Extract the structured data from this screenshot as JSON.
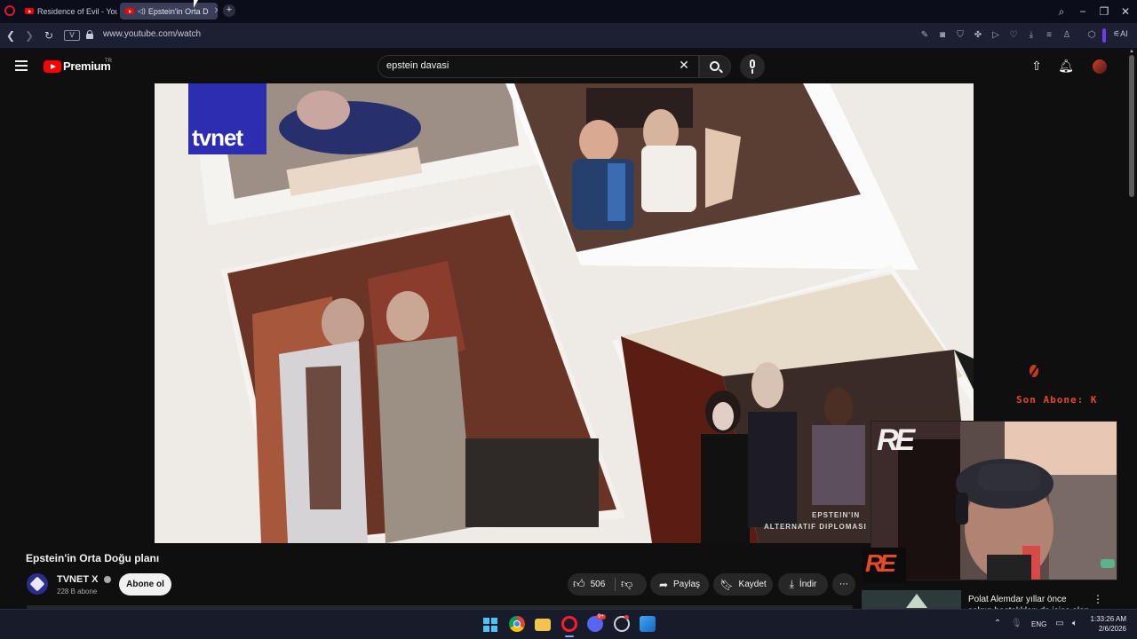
{
  "browser": {
    "tabs": [
      {
        "label": "Residence of Evil - YouTub",
        "active": false
      },
      {
        "label": "Epstein'in Orta D",
        "active": true
      }
    ],
    "new_tab": "+",
    "url": "www.youtube.com/watch",
    "url_badge": "V"
  },
  "youtube": {
    "logo_text": "Premium",
    "logo_region": "TR",
    "search_value": "epstein davasi"
  },
  "video": {
    "brand_overlay": "tvnet",
    "caption_line1": "EPSTEIN'IN",
    "caption_line2": "ALTERNATIF DIPLOMASI"
  },
  "overlay": {
    "son_abone": "Son Abone: K",
    "cam_logo": "RE",
    "colors": {
      "accent": "#e24a2a"
    }
  },
  "info": {
    "title": "Epstein'in Orta Doğu planı",
    "channel": "TVNET X",
    "subscribers": "228 B abone",
    "subscribe": "Abone ol",
    "likes": "506",
    "share": "Paylaş",
    "save": "Kaydet",
    "download": "İndir",
    "more": "⋯"
  },
  "recommendation": {
    "title": "Polat Alemdar yıllar önce salgın hastalıkları da işiçe alan kıdi"
  },
  "taskbar": {
    "lang": "ENG",
    "time": "1:33:26 AM",
    "date": "2/6/2026",
    "discord_badge": "9+"
  }
}
